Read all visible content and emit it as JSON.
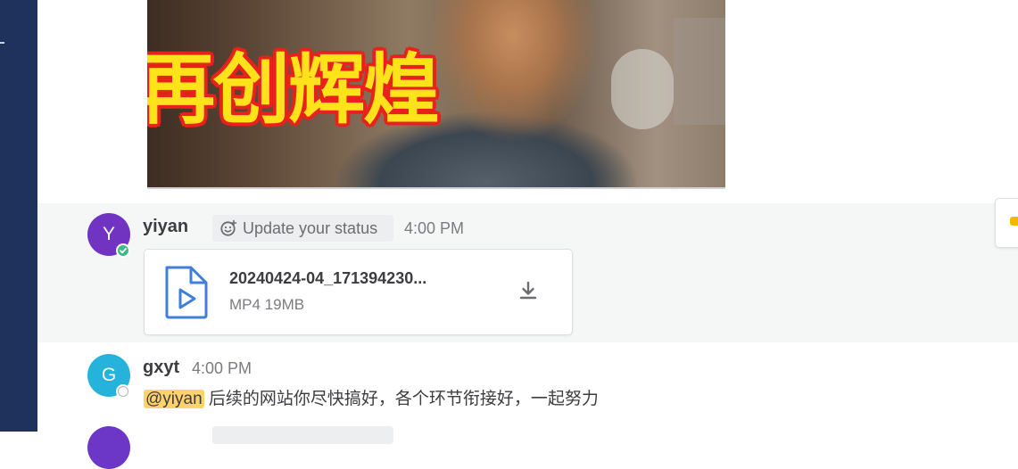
{
  "colors": {
    "sidebar": "#1e325c",
    "avatar_yiyan": "#7133c2",
    "avatar_gxyt": "#26b3db",
    "online": "#3db887",
    "mention_bg": "#ffd36b",
    "file_icon": "#3f7fd9"
  },
  "video_caption": "再创辉煌",
  "messages": [
    {
      "avatar_letter": "Y",
      "username": "yiyan",
      "status_chip": "Update your status",
      "status_chip_icon": "smiley-plus-icon",
      "time": "4:00 PM",
      "presence": "online",
      "file": {
        "icon": "video-file-icon",
        "name": "20240424-04_171394230...",
        "meta": "MP4 19MB",
        "action_icon": "download-icon"
      }
    },
    {
      "avatar_letter": "G",
      "username": "gxyt",
      "time": "4:00 PM",
      "presence": "offline",
      "mention": "@yiyan",
      "text": " 后续的网站你尽快搞好，各个环节衔接好，一起努力"
    }
  ]
}
